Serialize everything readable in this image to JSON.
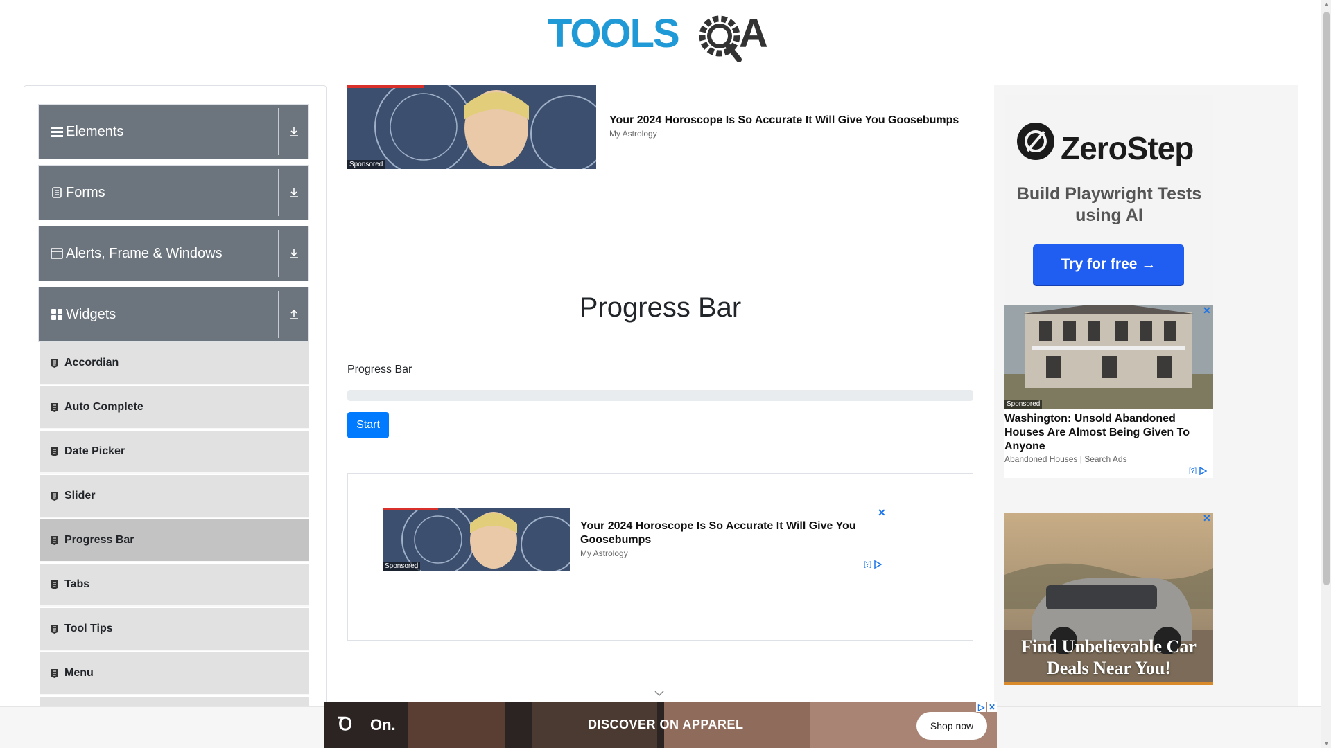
{
  "header": {
    "logo_text": "TOOLSQA"
  },
  "sidebar": {
    "groups": [
      {
        "label": "Elements",
        "icon": "hamburger-icon",
        "toggle": "download-icon"
      },
      {
        "label": "Forms",
        "icon": "document-icon",
        "toggle": "download-icon"
      },
      {
        "label": "Alerts, Frame & Windows",
        "icon": "window-icon",
        "toggle": "download-icon"
      },
      {
        "label": "Widgets",
        "icon": "widgets-icon",
        "toggle": "upload-icon"
      }
    ],
    "items": [
      {
        "label": "Accordian"
      },
      {
        "label": "Auto Complete"
      },
      {
        "label": "Date Picker"
      },
      {
        "label": "Slider"
      },
      {
        "label": "Progress Bar",
        "active": true
      },
      {
        "label": "Tabs"
      },
      {
        "label": "Tool Tips"
      },
      {
        "label": "Menu"
      }
    ]
  },
  "top_ad": {
    "title": "Your 2024 Horoscope Is So Accurate It Will Give You Goosebumps",
    "source": "My Astrology",
    "sponsored": "Sponsored"
  },
  "main": {
    "page_title": "Progress Bar",
    "progress_label": "Progress Bar",
    "progress_value": 0,
    "start_button": "Start"
  },
  "inline_ad": {
    "title": "Your 2024 Horoscope Is So Accurate It Will Give You Goosebumps",
    "source": "My Astrology",
    "sponsored": "Sponsored",
    "adchoices": "[?]"
  },
  "right_ads": {
    "zerostep": {
      "brand": "ZeroStep",
      "subtitle": "Build Playwright Tests using AI",
      "button": "Try for free →"
    },
    "house": {
      "sponsored": "Sponsored",
      "title": "Washington: Unsold Abandoned Houses Are Almost Being Given To Anyone",
      "source": "Abandoned Houses | Search Ads",
      "adchoices": "[?]"
    },
    "car": {
      "headline": "Find Unbelievable Car Deals Near You!"
    }
  },
  "bottom_ad": {
    "brand": "On.",
    "headline": "DISCOVER ON APPAREL",
    "button": "Shop now"
  },
  "colors": {
    "primary": "#007bff",
    "sidebar_group": "#6c757d",
    "menu_item": "#e1e1e1",
    "menu_item_active": "#c3c3c3",
    "progress_track": "#e9ecef",
    "logo_blue": "#1f9ad6"
  }
}
